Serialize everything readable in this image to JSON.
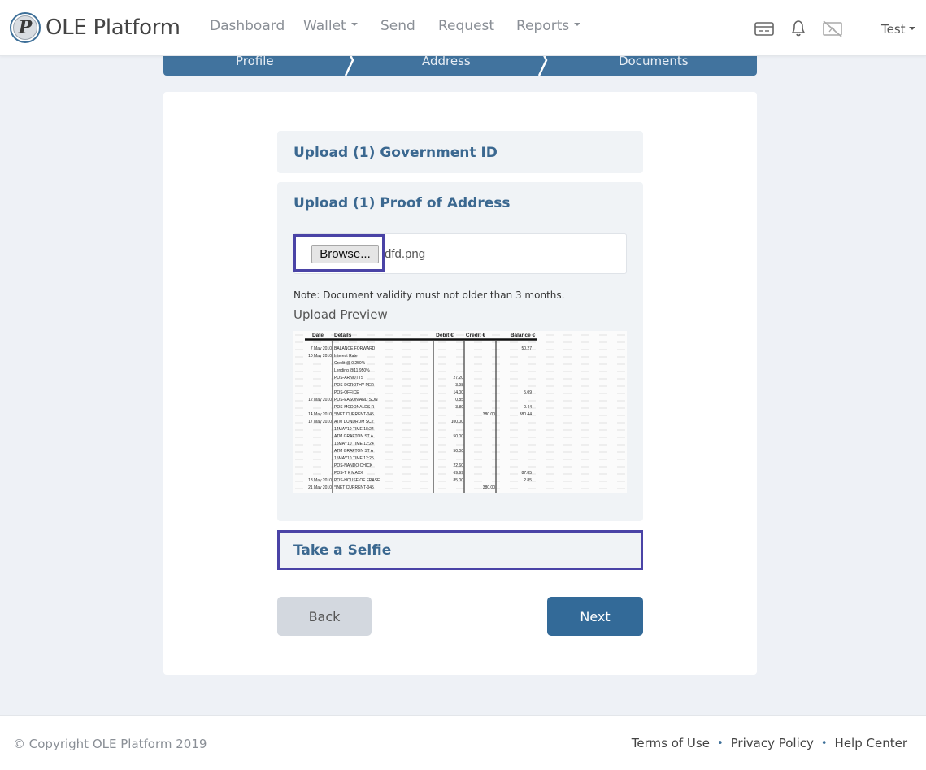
{
  "brand": {
    "name": "OLE Platform",
    "logo_letter": "P"
  },
  "nav": {
    "items": [
      {
        "label": "Dashboard",
        "dropdown": false
      },
      {
        "label": "Wallet",
        "dropdown": true
      },
      {
        "label": "Send",
        "dropdown": false
      },
      {
        "label": "Request",
        "dropdown": false
      },
      {
        "label": "Reports",
        "dropdown": true
      }
    ],
    "icons": [
      "card-icon",
      "bell-icon",
      "no-camera-icon"
    ],
    "user": "Test"
  },
  "stepper": {
    "steps": [
      "Profile",
      "Address",
      "Documents"
    ]
  },
  "upload": {
    "government_id_title": "Upload (1) Government ID",
    "proof_title": "Upload (1) Proof of Address",
    "browse_label": "Browse...",
    "file_name": "dfd.png",
    "note": "Note: Document validity must not older than 3 months.",
    "preview_label": "Upload Preview",
    "selfie_title": "Take a Selfie"
  },
  "preview_doc": {
    "headers": [
      "Date",
      "Details",
      "Debit €",
      "Credit €",
      "Balance €"
    ],
    "rows": [
      [
        "7 May 2010",
        "BALANCE FORWARD",
        "",
        "",
        "50.27"
      ],
      [
        "10 May 2010",
        "Interest Rate",
        "",
        "",
        ""
      ],
      [
        "",
        "Credit @ 0.250%",
        "",
        "",
        ""
      ],
      [
        "",
        "Lending @11.950%",
        "",
        "",
        ""
      ],
      [
        "",
        "POS-ARNOTTS",
        "27.20",
        "",
        ""
      ],
      [
        "",
        "POS-DOROTHY PER",
        "3.98",
        "",
        ""
      ],
      [
        "",
        "POS-OFFICE",
        "14.00",
        "",
        "5.09"
      ],
      [
        "12 May 2010",
        "POS-EASON AND SON",
        "0.85",
        "",
        ""
      ],
      [
        "",
        "POS-MCDONALDS R",
        "3.80",
        "",
        "0.44"
      ],
      [
        "14 May 2010",
        "*INET CURRENT-045",
        "",
        "380.00",
        "380.44"
      ],
      [
        "17 May 2010",
        "ATM DUNDRUM SC2",
        "100.00",
        "",
        ""
      ],
      [
        "",
        "14MAY10 TIME 18:24",
        "",
        "",
        ""
      ],
      [
        "",
        "ATM GRAFTON ST A",
        "50.00",
        "",
        ""
      ],
      [
        "",
        "15MAY10 TIME 12:24",
        "",
        "",
        ""
      ],
      [
        "",
        "ATM GRAFTON ST A",
        "50.00",
        "",
        ""
      ],
      [
        "",
        "15MAY10 TIME 12:25",
        "",
        "",
        ""
      ],
      [
        "",
        "POS-NANDO CHICK",
        "22.60",
        "",
        ""
      ],
      [
        "",
        "POS-T K MAXX",
        "69.99",
        "",
        "87.85"
      ],
      [
        "18 May 2010",
        "POS-HOUSE OF FRASE",
        "85.00",
        "",
        "2.85"
      ],
      [
        "21 May 2010",
        "*INET CURRENT-045",
        "",
        "380.00",
        ""
      ]
    ]
  },
  "buttons": {
    "back": "Back",
    "next": "Next"
  },
  "footer": {
    "copyright": "© Copyright OLE Platform 2019",
    "links": [
      "Terms of Use",
      "Privacy Policy",
      "Help Center"
    ]
  },
  "colors": {
    "primary": "#336a98",
    "stepper": "#41739e",
    "highlight": "#4a43a6",
    "panel": "#f0f3f6"
  }
}
